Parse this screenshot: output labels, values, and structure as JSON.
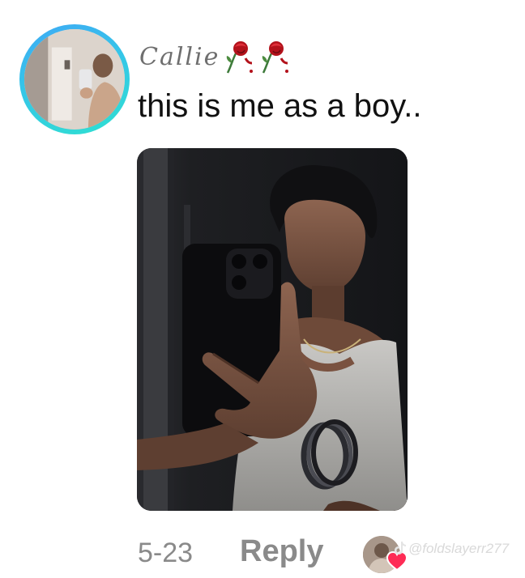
{
  "comment": {
    "username": "Callie",
    "username_icons": [
      "rose-icon",
      "rose-icon"
    ],
    "text": "this is me as a boy..",
    "date": "5-23",
    "reply_label": "Reply",
    "liked_by_creator": true
  },
  "watermark": {
    "handle": "@foldslayerr277",
    "icon": "tiktok-logo-icon"
  },
  "colors": {
    "avatar_ring_start": "#3fa9f5",
    "avatar_ring_end": "#2fe0d0",
    "muted_text": "#8a8a8a",
    "heart": "#fe2c55"
  }
}
